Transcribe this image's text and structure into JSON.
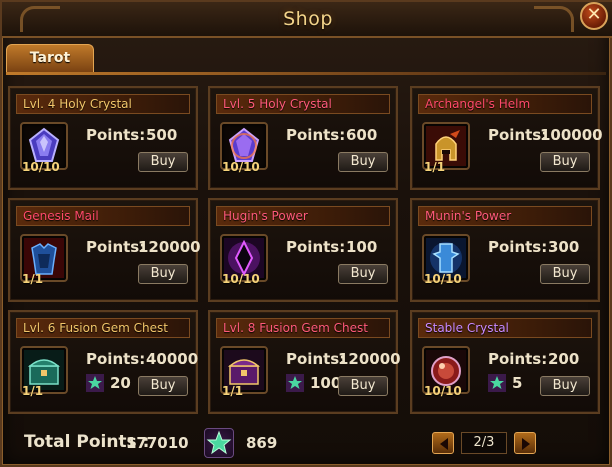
{
  "window": {
    "title": "Shop",
    "close_label": "✕"
  },
  "tabs": [
    {
      "label": "Tarot",
      "active": true
    }
  ],
  "points_label": "Points:",
  "buy_label": "Buy",
  "items": [
    {
      "name": "Lvl. 4 Holy Crystal",
      "name_color": "#f2c66a",
      "points": "500",
      "stock": "10/10",
      "icon": "holy-crystal-icon"
    },
    {
      "name": "Lvl. 5 Holy Crystal",
      "name_color": "#ff5a7a",
      "points": "600",
      "stock": "10/10",
      "icon": "holy-crystal-icon"
    },
    {
      "name": "Archangel's Helm",
      "name_color": "#ff4a6a",
      "points": "100000",
      "stock": "1/1",
      "icon": "helm-icon"
    },
    {
      "name": "Genesis Mail",
      "name_color": "#ff4a6a",
      "points": "120000",
      "stock": "1/1",
      "icon": "armor-icon"
    },
    {
      "name": "Hugin's Power",
      "name_color": "#ff5a7a",
      "points": "100",
      "stock": "10/10",
      "icon": "dark-gem-icon"
    },
    {
      "name": "Munin's Power",
      "name_color": "#ff5a7a",
      "points": "300",
      "stock": "10/10",
      "icon": "totem-icon"
    },
    {
      "name": "Lvl. 6 Fusion Gem Chest",
      "name_color": "#f2c66a",
      "points": "40000",
      "stars": "20",
      "stock": "1/1",
      "icon": "gem-chest-icon"
    },
    {
      "name": "Lvl. 8 Fusion Gem Chest",
      "name_color": "#ff5a7a",
      "points": "120000",
      "stars": "100",
      "stock": "1/1",
      "icon": "gem-chest-icon"
    },
    {
      "name": "Stable Crystal",
      "name_color": "#c98aff",
      "points": "200",
      "stars": "5",
      "stock": "10/10",
      "icon": "stable-crystal-icon"
    }
  ],
  "footer": {
    "total_label": "Total Points :",
    "total_points": "177010",
    "stars": "869",
    "star_icon": "star-currency-icon",
    "page": "2/3"
  },
  "colors": {
    "accent": "#c07a2a",
    "gold_text": "#f5d27a",
    "frame": "#5b3d20"
  }
}
